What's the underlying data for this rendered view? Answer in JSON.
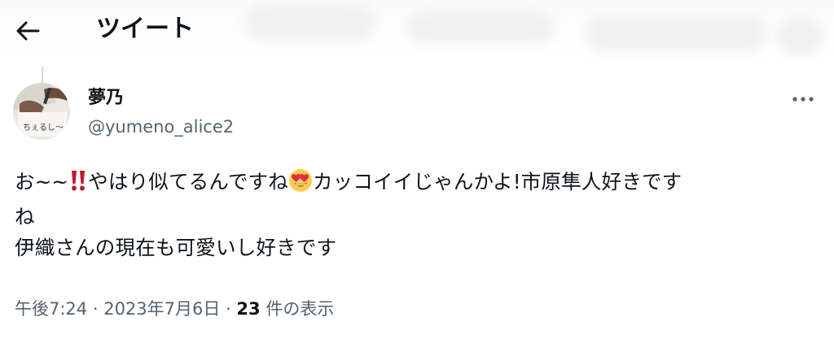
{
  "header": {
    "title": "ツイート",
    "back_icon": "arrow-left-icon"
  },
  "tweet": {
    "author": {
      "name": "夢乃",
      "handle": "@yumeno_alice2",
      "avatar_text": "ちぇるし〜"
    },
    "more_icon": "more-horizontal-icon",
    "text_parts": {
      "l1_a": "お~~",
      "emoji_exclaim": "double-exclamation-emoji",
      "l1_b": "やはり似てるんですね",
      "emoji_heart_eyes": "heart-eyes-emoji",
      "l1_c": "カッコイイじゃんかよ!市原隼人好きです",
      "l2": "ね",
      "l3": "伊織さんの現在も可愛いし好きです"
    },
    "meta": {
      "time": "午後7:24",
      "sep1": " · ",
      "date": "2023年7月6日",
      "sep2": " · ",
      "views_count": "23",
      "views_label": " 件の表示"
    }
  }
}
